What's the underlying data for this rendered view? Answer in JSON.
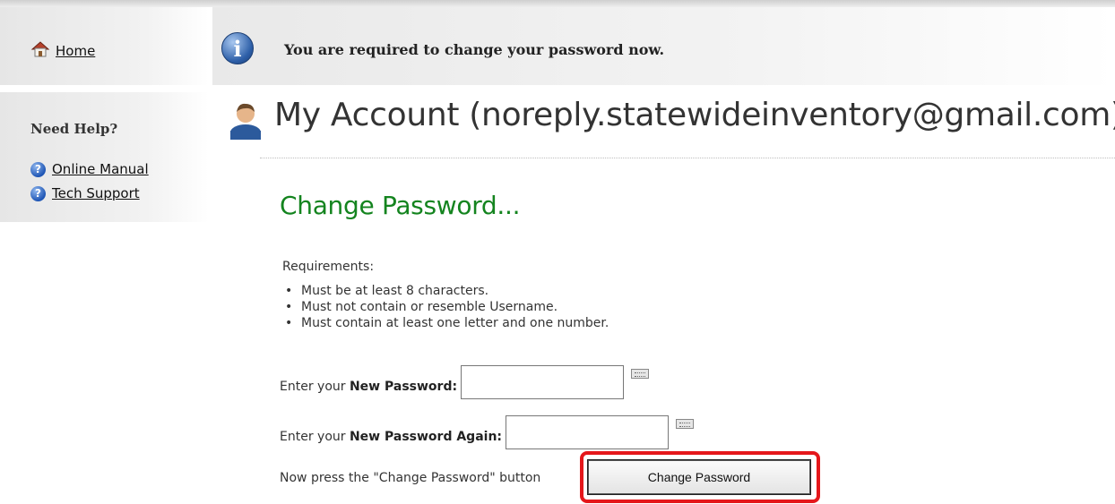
{
  "sidebar": {
    "home_label": "Home",
    "need_help_title": "Need Help?",
    "help_links": [
      {
        "label": "Online Manual",
        "icon": "help-question-icon"
      },
      {
        "label": "Tech Support",
        "icon": "help-question-icon"
      }
    ]
  },
  "notice": {
    "icon": "info-icon",
    "message": "You are required to change your password now."
  },
  "account": {
    "icon": "user-icon",
    "title": "My Account (noreply.statewideinventory@gmail.com)"
  },
  "change_password": {
    "heading": "Change Password...",
    "requirements_label": "Requirements:",
    "requirements": [
      "Must be at least 8 characters.",
      "Must not contain or resemble Username.",
      "Must contain at least one letter and one number."
    ],
    "new_password_prefix": "Enter your ",
    "new_password_bold": "New Password:",
    "new_password_value": "",
    "new_password_again_prefix": "Enter your ",
    "new_password_again_bold": "New Password Again:",
    "new_password_again_value": "",
    "press_instruction": "Now press the \"Change Password\" button",
    "button_label": "Change Password"
  },
  "colors": {
    "heading_green": "#14841f",
    "highlight_red": "#e5171b",
    "info_blue": "#2d5fa8"
  }
}
